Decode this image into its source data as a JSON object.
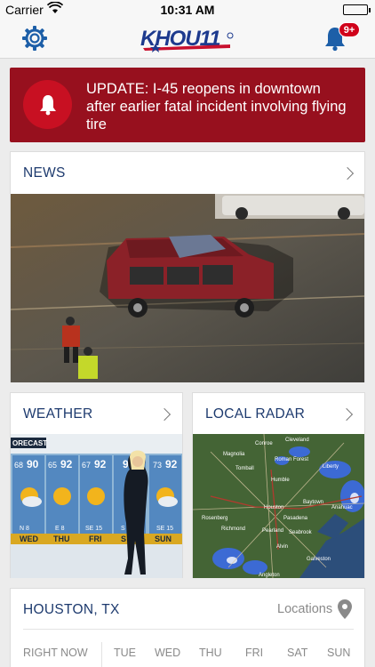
{
  "status_bar": {
    "carrier": "Carrier",
    "time": "10:31 AM"
  },
  "nav": {
    "logo_text": "KHOU11",
    "notification_count": "9+",
    "colors": {
      "brand": "#1d3a6e",
      "badge": "#d0021b"
    }
  },
  "alert": {
    "text": "UPDATE: I-45 reopens in downtown after earlier fatal incident involving flying tire",
    "background": "#97101e"
  },
  "news": {
    "title": "NEWS"
  },
  "weather": {
    "title": "WEATHER",
    "forecast_banner": "ORECAST",
    "days": [
      {
        "lo": "68",
        "hi": "90",
        "wind": "N 8",
        "day": "WED"
      },
      {
        "lo": "65",
        "hi": "92",
        "wind": "E 8",
        "day": "THU"
      },
      {
        "lo": "67",
        "hi": "92",
        "wind": "SE 15",
        "day": "FRI"
      },
      {
        "lo": "",
        "hi": "92",
        "wind": "S",
        "day": "S"
      },
      {
        "lo": "73",
        "hi": "92",
        "wind": "SE 15",
        "day": "SUN"
      }
    ]
  },
  "radar": {
    "title": "LOCAL RADAR",
    "places": [
      "Cleveland",
      "Conroe",
      "Magnolia",
      "Roman Forest",
      "Tomball",
      "Humble",
      "Liberty",
      "Houston",
      "Anahuac",
      "Richmond",
      "Pasadena",
      "Baytown",
      "Seabrook",
      "Alvin",
      "Galveston",
      "Angleton",
      "Pearland",
      "Rosenberg"
    ]
  },
  "location": {
    "city": "HOUSTON, TX",
    "locations_label": "Locations",
    "right_now_label": "RIGHT NOW",
    "forecast_days": [
      "TUE",
      "WED",
      "THU",
      "FRI",
      "SAT",
      "SUN"
    ]
  }
}
